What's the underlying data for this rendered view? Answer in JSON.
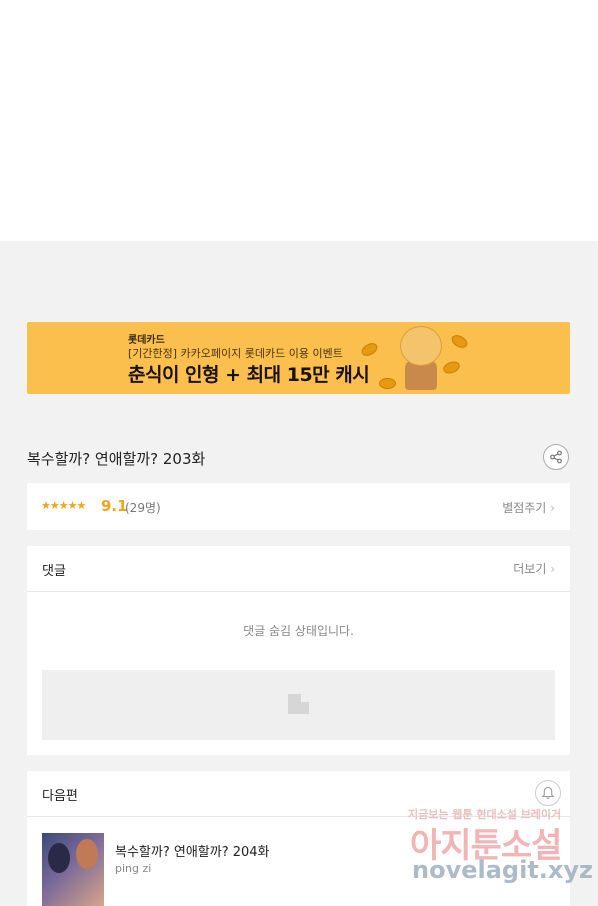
{
  "banner": {
    "brand": "롯데카드",
    "sub": "[기간한정] 카카오페이지 롯데카드 이용 이벤트",
    "headline": "춘식이 인형 + 최대 15만 캐시"
  },
  "episode": {
    "title": "복수할까? 연애할까? 203화"
  },
  "rating": {
    "stars": "★★★★★",
    "score": "9.1",
    "count": "(29명)",
    "rate_link": "별점주기"
  },
  "comments": {
    "title": "댓글",
    "more": "더보기",
    "hidden_message": "댓글 숨김 상태입니다."
  },
  "next": {
    "title": "다음편",
    "episode_title": "복수할까? 연애할까? 204화",
    "author": "ping zi"
  },
  "watermark": {
    "line1": "지금보는 웹툰 현대소설 브레이거",
    "line2": "아지툰소설",
    "line3": "novelagit.xyz"
  },
  "colors": {
    "accent": "#f0a51a",
    "banner_bg": "#fbbf4e",
    "page_bg": "#f2f2f2"
  }
}
